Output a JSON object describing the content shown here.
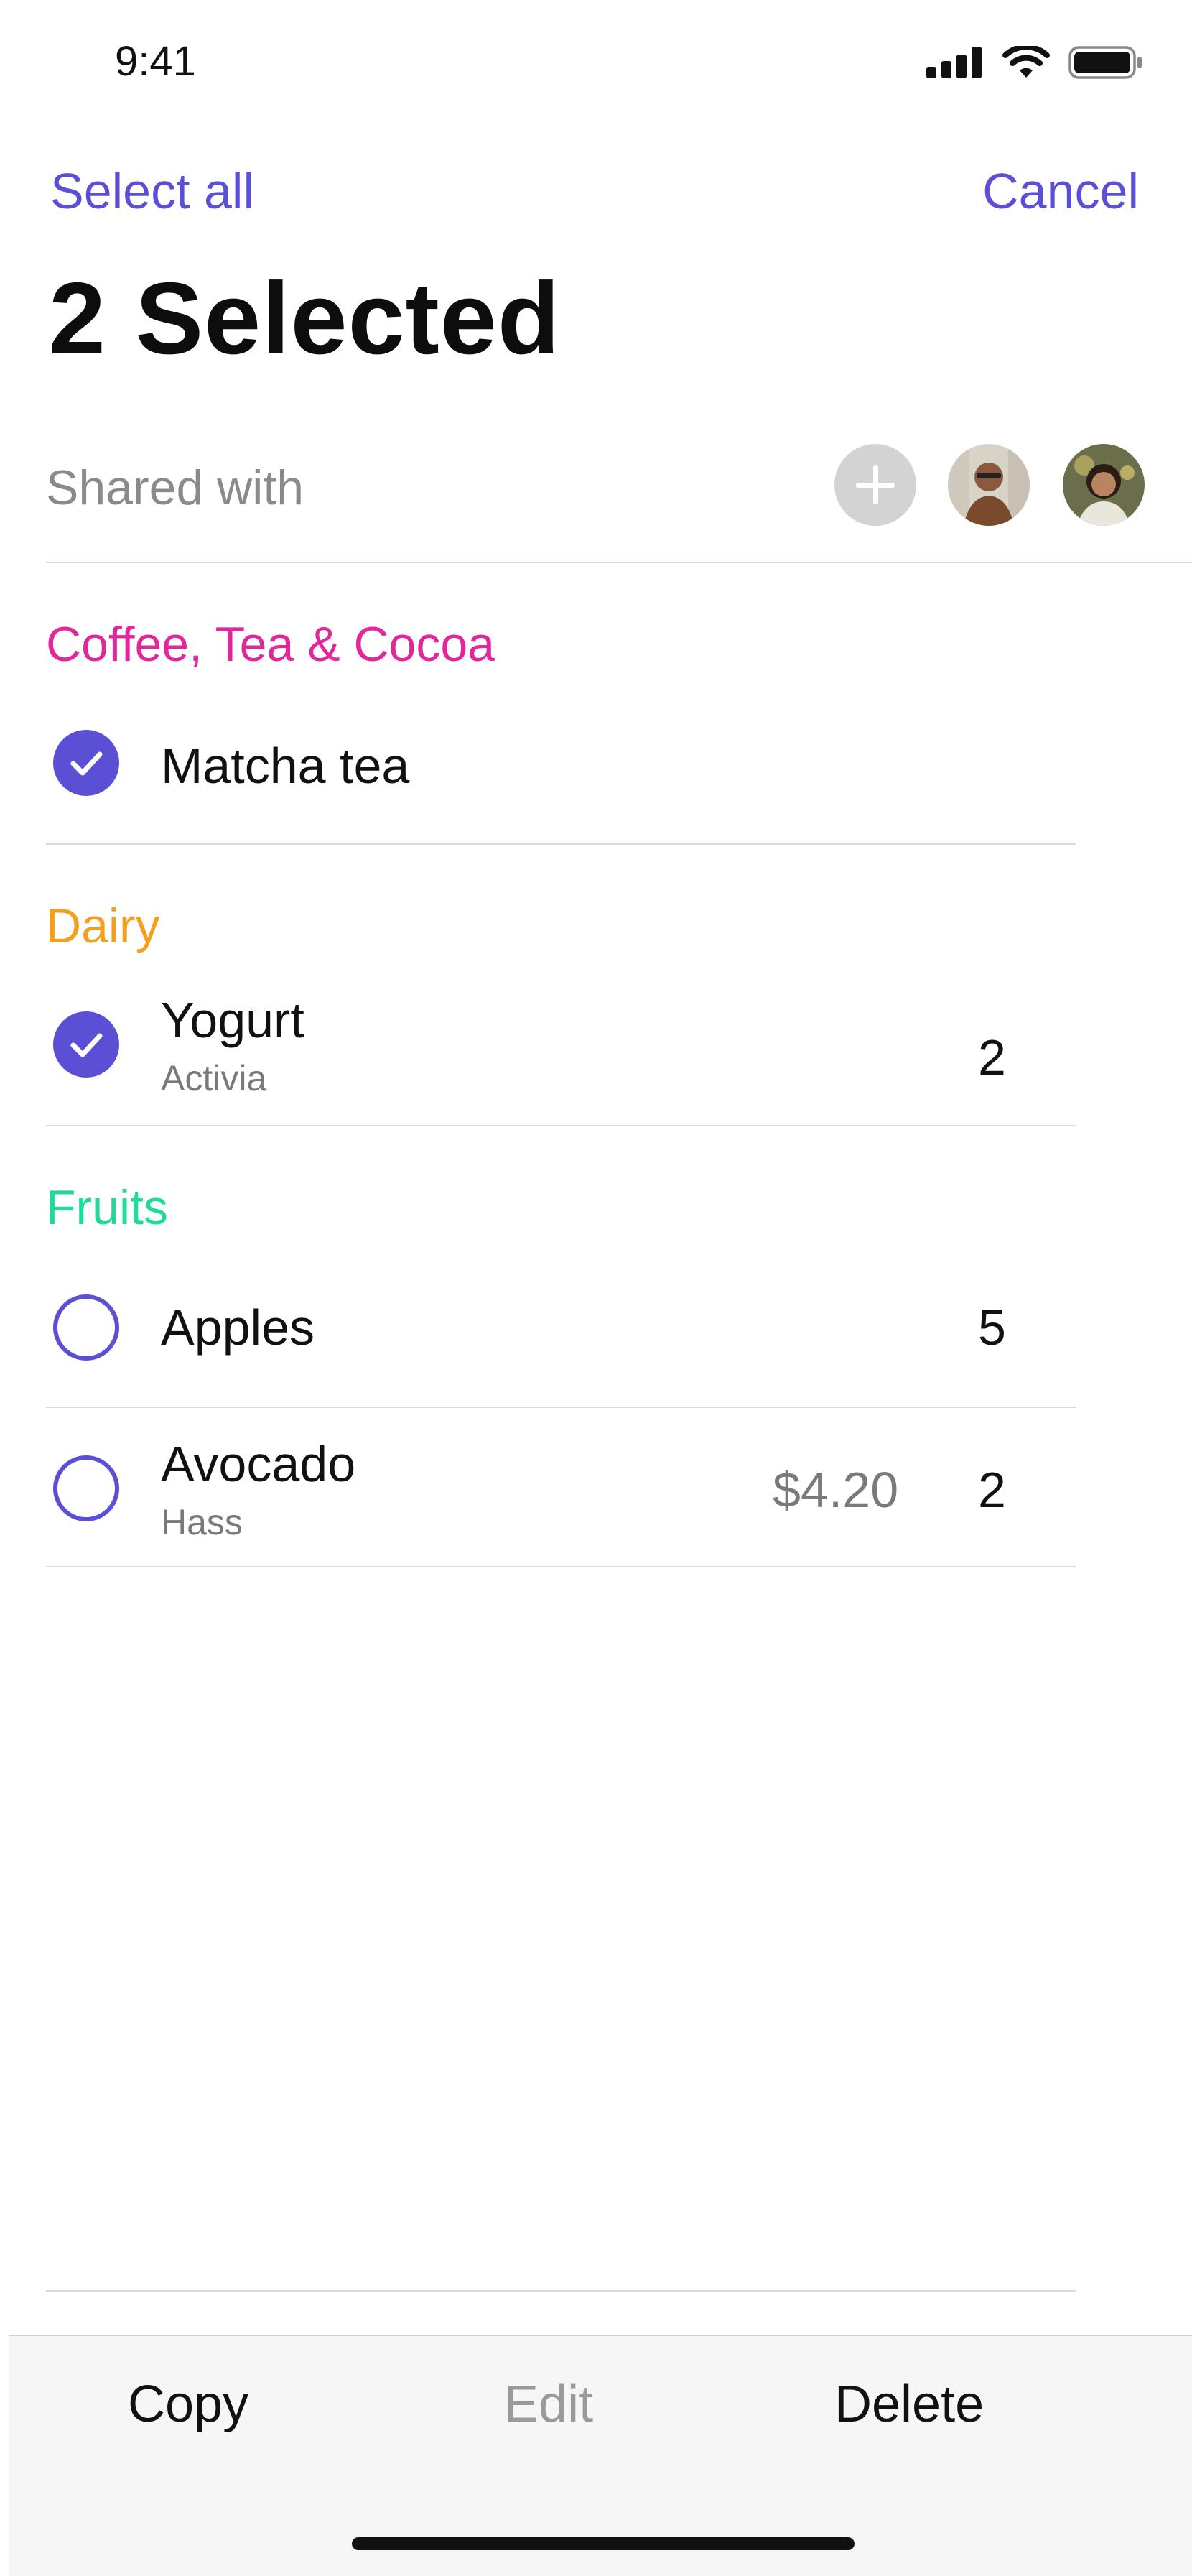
{
  "status_bar": {
    "time": "9:41",
    "icons": [
      "signal-icon",
      "wifi-icon",
      "battery-icon"
    ]
  },
  "header": {
    "select_all": "Select all",
    "cancel": "Cancel",
    "title": "2 Selected"
  },
  "shared": {
    "label": "Shared with",
    "add_icon": "plus-icon"
  },
  "sections": [
    {
      "name": "Coffee, Tea & Cocoa",
      "color": "#e0289a",
      "items": [
        {
          "name": "Matcha tea",
          "sub": "",
          "price": "",
          "qty": "",
          "checked": true
        }
      ]
    },
    {
      "name": "Dairy",
      "color": "#f3a01f",
      "items": [
        {
          "name": "Yogurt",
          "sub": "Activia",
          "price": "",
          "qty": "2",
          "checked": true
        }
      ]
    },
    {
      "name": "Fruits",
      "color": "#23d99a",
      "items": [
        {
          "name": "Apples",
          "sub": "",
          "price": "",
          "qty": "5",
          "checked": false
        },
        {
          "name": "Avocado",
          "sub": "Hass",
          "price": "$4.20",
          "qty": "2",
          "checked": false
        }
      ]
    }
  ],
  "toolbar": {
    "copy": "Copy",
    "edit": "Edit",
    "delete": "Delete"
  },
  "colors": {
    "accent": "#5b4fd6",
    "disabled": "#9a9a9a"
  }
}
